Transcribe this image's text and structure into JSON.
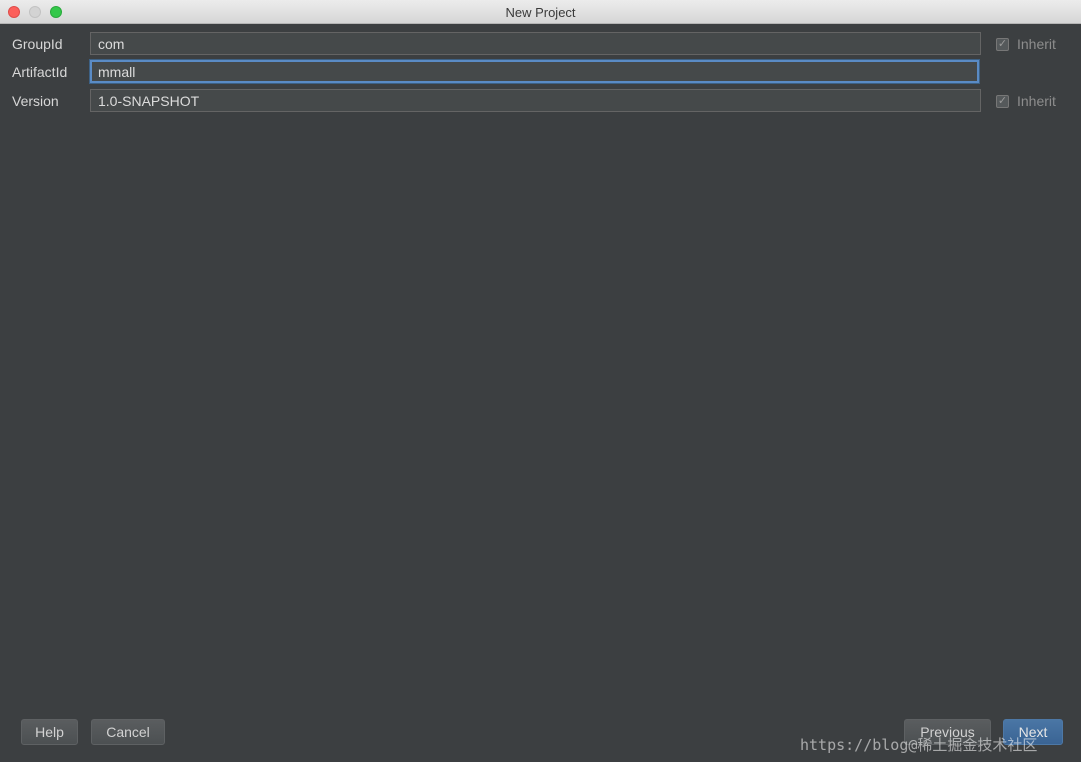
{
  "window": {
    "title": "New Project"
  },
  "form": {
    "group_id": {
      "label": "GroupId",
      "value": "com",
      "inherit_label": "Inherit",
      "inherit_checked": true
    },
    "artifact_id": {
      "label": "ArtifactId",
      "value": "mmall"
    },
    "version": {
      "label": "Version",
      "value": "1.0-SNAPSHOT",
      "inherit_label": "Inherit",
      "inherit_checked": true
    }
  },
  "footer": {
    "help_label": "Help",
    "cancel_label": "Cancel",
    "previous_label": "Previous",
    "next_label": "Next"
  },
  "watermark": {
    "text": "https://blog@稀土掘金技术社区"
  },
  "colors": {
    "background": "#3c3f41",
    "field_focus": "#5a8bc5",
    "primary_button": "#3a6494"
  }
}
